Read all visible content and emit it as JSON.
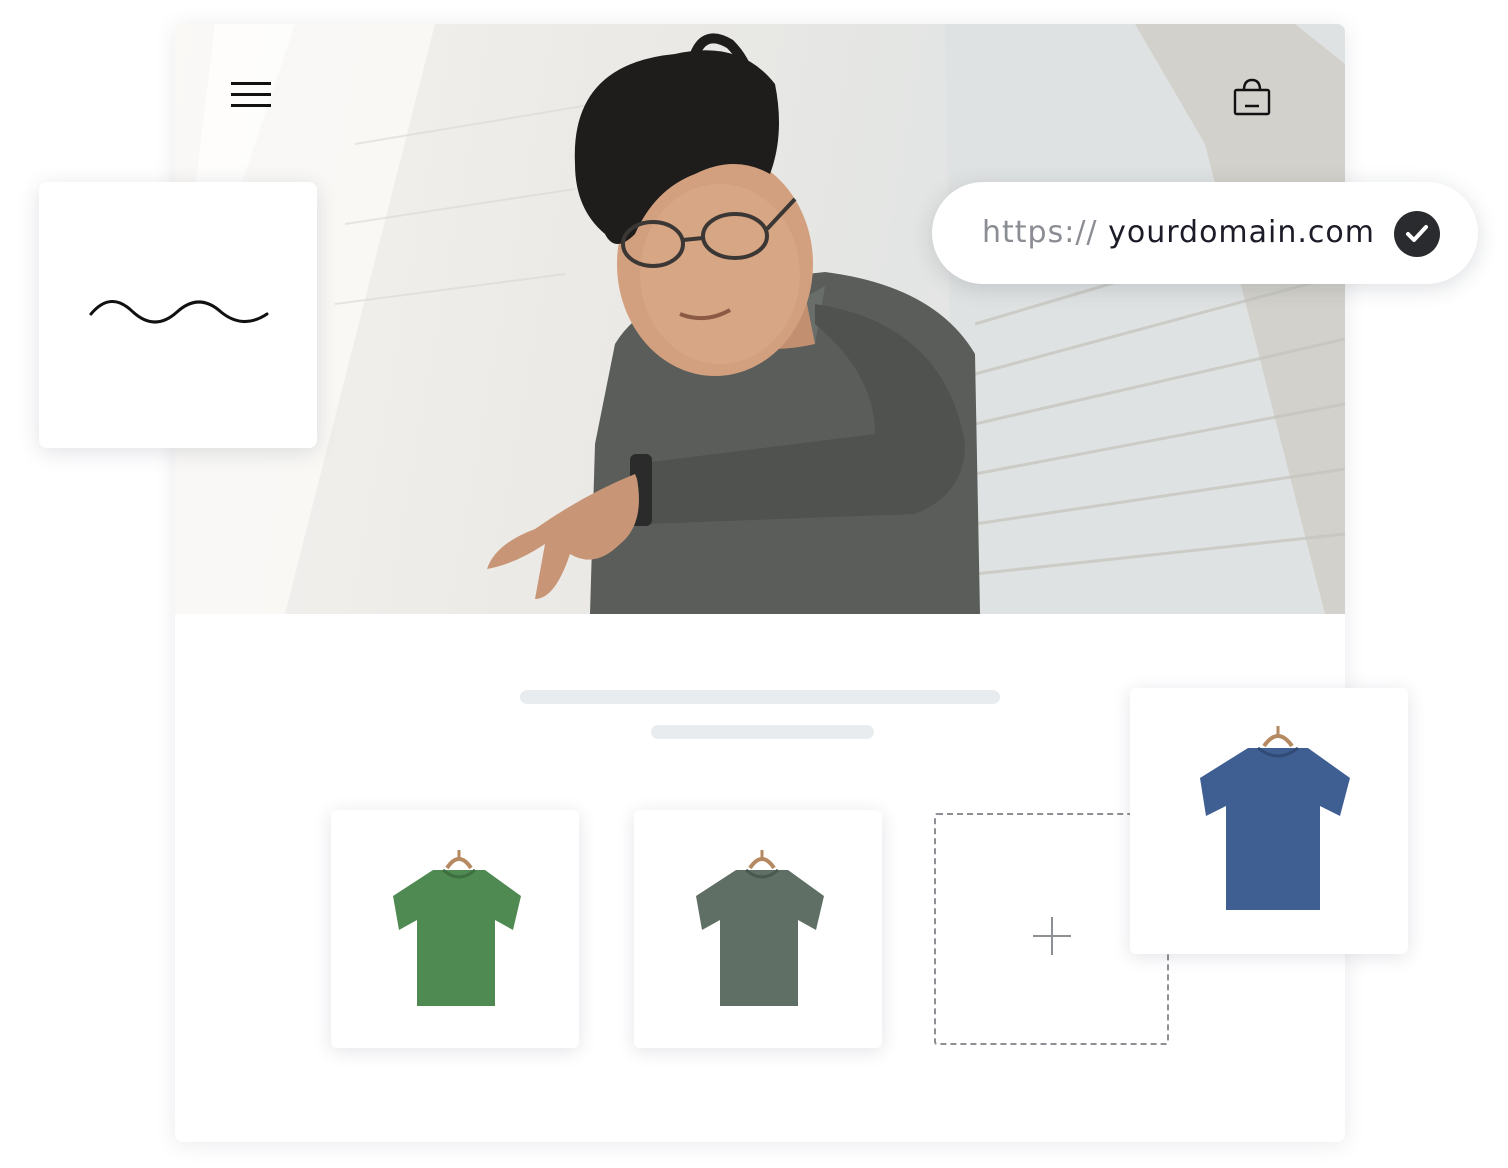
{
  "site_header": {
    "menu_icon": "hamburger-menu-icon",
    "cart_icon": "shopping-bag-icon"
  },
  "hero": {
    "image": "man-in-grey-tshirt-checking-watch-photo"
  },
  "logo_card": {
    "logo": "wave-line-logo"
  },
  "domain_pill": {
    "prefix": "https://",
    "domain": "yourdomain.com",
    "status_icon": "check-circle-icon"
  },
  "products": [
    {
      "name": "green-tshirt",
      "color": "#4f8a52"
    },
    {
      "name": "grey-green-tshirt",
      "color": "#5f6f66"
    },
    {
      "name": "blue-tshirt",
      "color": "#3f5f93"
    }
  ],
  "add_product": {
    "icon": "plus-icon"
  },
  "colors": {
    "placeholder_line": "#e9ecef",
    "dashed_border": "#8c8f94",
    "check_bg": "#2a2b2e"
  }
}
